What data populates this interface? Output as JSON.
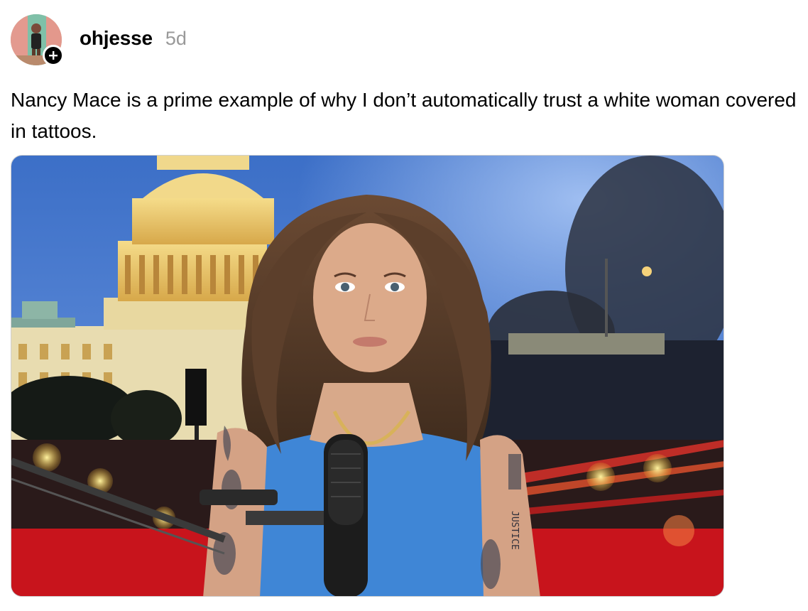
{
  "post": {
    "username": "ohjesse",
    "timestamp": "5d",
    "text": "Nancy Mace is a prime example of why I don’t automatically trust a white woman covered in tattoos.",
    "avatar_icon": "profile-avatar",
    "follow_icon": "plus-icon",
    "image_tattoo_text": "JUSTICE"
  },
  "colors": {
    "text": "#000000",
    "muted": "#999999",
    "sky": "#4a78c8",
    "dress": "#3f86d6",
    "floor": "#c8141c"
  }
}
